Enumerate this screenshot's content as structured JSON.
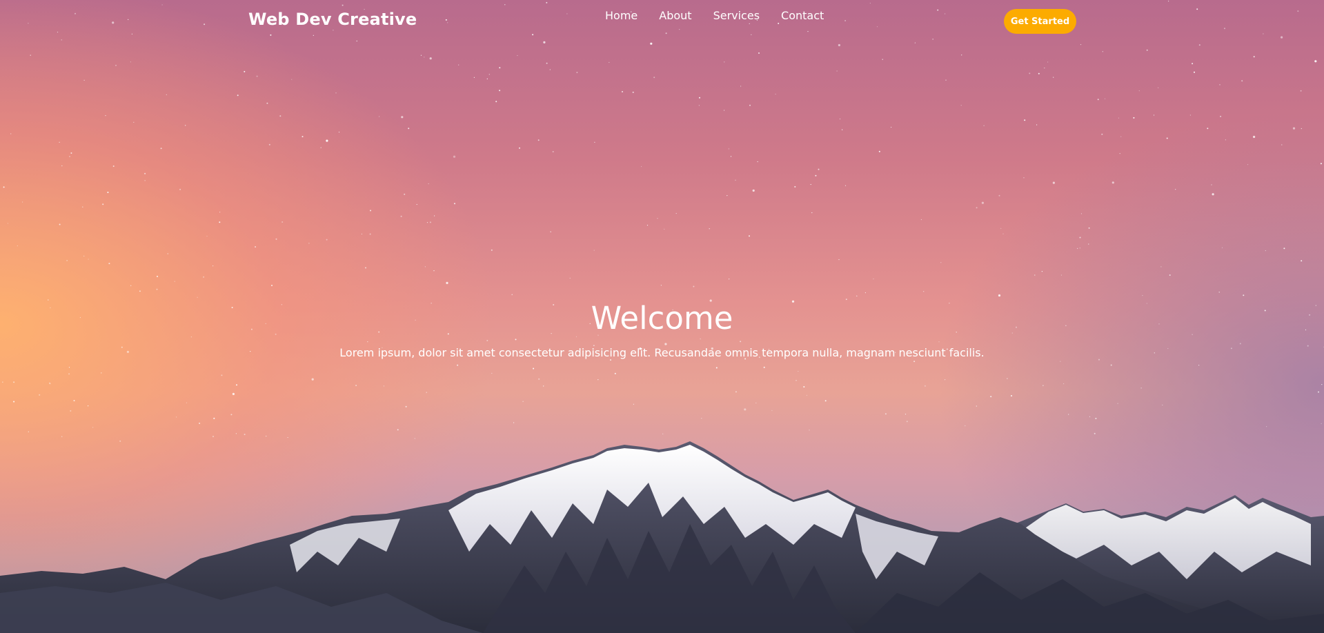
{
  "brand": {
    "name": "Web Dev Creative"
  },
  "nav": {
    "links": [
      {
        "label": "Home"
      },
      {
        "label": "About"
      },
      {
        "label": "Services"
      },
      {
        "label": "Contact"
      }
    ],
    "cta_label": "Get Started"
  },
  "hero": {
    "title": "Welcome",
    "subtitle": "Lorem ipsum, dolor sit amet consectetur adipisicing elit. Recusandae omnis tempora nulla, magnam nesciunt facilis."
  },
  "colors": {
    "accent": "#fcab00",
    "text": "#ffffff",
    "sky_top": "#b86b8d",
    "sky_glow": "#ffb26e",
    "mountain_shadow": "#353749",
    "snow": "#f2f1f6"
  }
}
